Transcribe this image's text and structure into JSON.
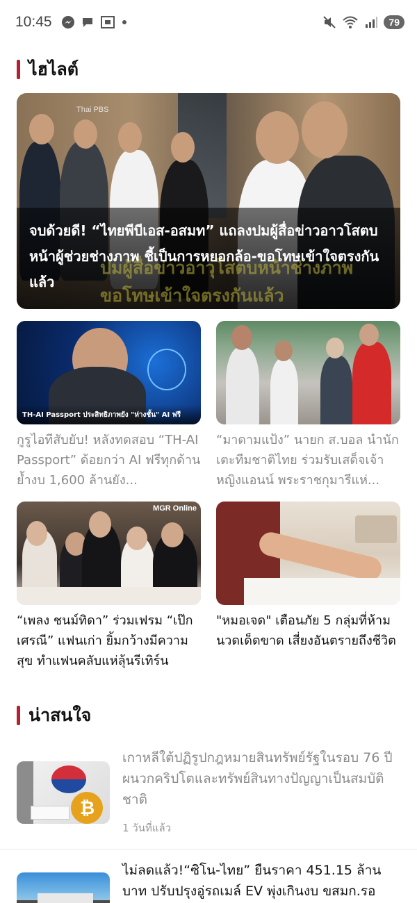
{
  "status_bar": {
    "time": "10:45",
    "left_icons": [
      "messenger-icon",
      "chat-icon",
      "screenshot-icon",
      "dot-icon"
    ],
    "right_icons": [
      "mute-icon",
      "wifi-icon",
      "signal-icon"
    ],
    "battery": "79"
  },
  "highlights": {
    "title": "ไฮไลต์",
    "hero": {
      "headline": "จบด้วยดี! “ไทยพีบีเอส-อสมท” แถลงปมผู้สื่อข่าวอาวโสตบหน้าผู้ช่วยช่างภาพ ชี้เป็นการหยอกล้อ-ขอโทษเข้าใจตรงกันแล้ว",
      "image_text": "ปมผู้สื่อข่าวอาวุโสตบหน้าช่างภาพ ขอโทษเข้าใจตรงกันแล้ว",
      "logo_text": "Thai PBS"
    },
    "cards": [
      {
        "title": "กูรูไอทีสับยับ! หลังทดสอบ “TH-AI Passport” ด้อยกว่า AI ฟรีทุกด้าน ย้ำงบ 1,600 ล้านยัง...",
        "image_caption": "TH-AI Passport ประสิทธิภาพยัง \"ห่างชั้น\" AI ฟรี",
        "read": true
      },
      {
        "title": "“มาดามแป้ง” นายก ส.บอล นำนักเตะทีมชาติไทย ร่วมรับเสด็จเจ้าหญิงแอนน์ พระราชกุมารีแห่...",
        "read": true
      },
      {
        "title": "“เพลง ชนม์ทิดา” ร่วมเฟรม “เป๊ก เศรณี” แฟนเก่า ยิ้มกว้างมีความสุข ทำแฟนคลับแห่ลุ้นรีเทิร์น",
        "image_logo": "MGR Online",
        "read": false
      },
      {
        "title": "\"หมอเจด\" เตือนภัย 5 กลุ่มที่ห้ามนวดเด็ดขาด เสี่ยงอันตรายถึงชีวิต",
        "read": false
      }
    ]
  },
  "interesting": {
    "title": "น่าสนใจ",
    "items": [
      {
        "title": "เกาหลีใต้ปฏิรูปกฎหมายสินทรัพย์รัฐในรอบ 76 ปีผนวกคริปโตและทรัพย์สินทางปัญญาเป็นสมบัติชาติ",
        "time": "1 วันที่แล้ว",
        "read": true
      },
      {
        "title": "ไม่ลดแล้ว!“ซิโน-ไทย” ยืนราคา 451.15 ล้านบาท ปรับปรุงอู่รถเมล์ EV พุ่งเกินงบ ขสมก.รอ",
        "read": false
      }
    ]
  }
}
